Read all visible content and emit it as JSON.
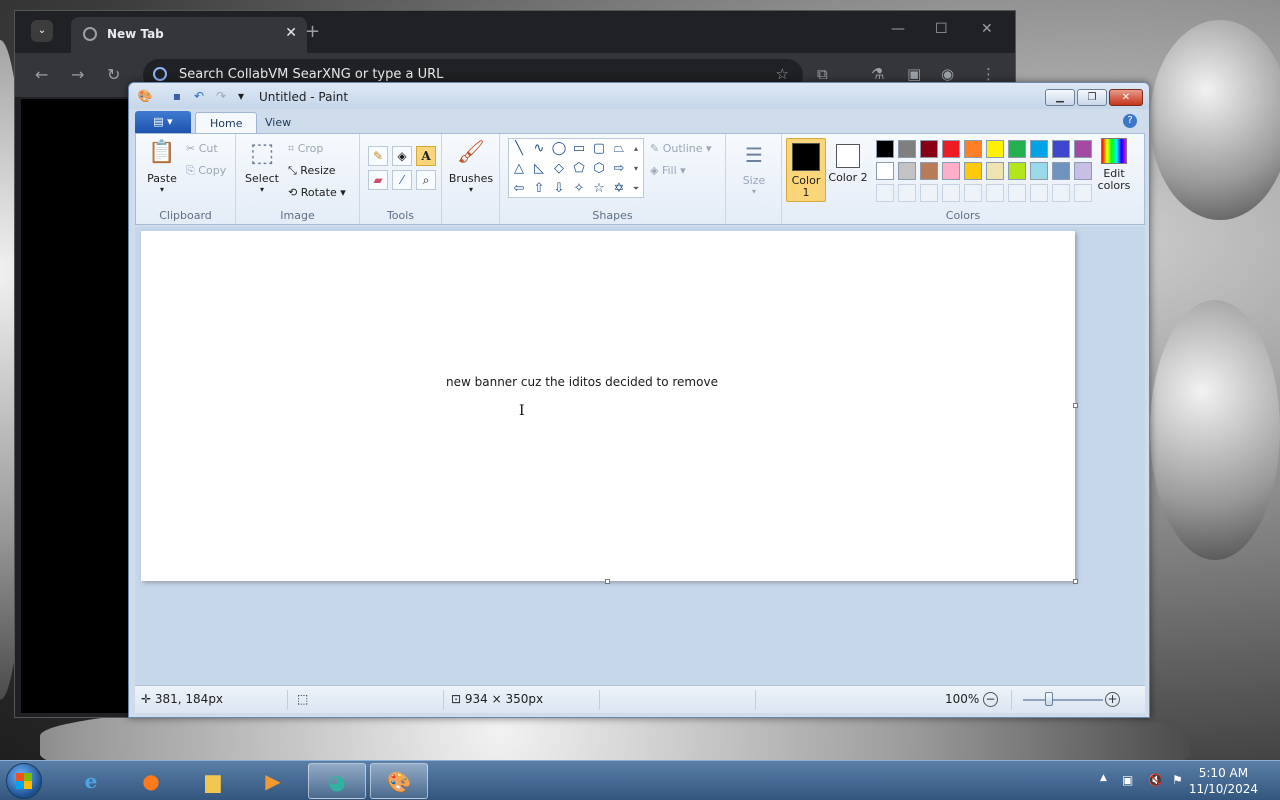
{
  "chrome": {
    "tab_title": "New Tab",
    "tab_close": "✕",
    "new_tab": "+",
    "omnibox_placeholder": "Search CollabVM SearXNG or type a URL"
  },
  "paint": {
    "window_title": "Untitled - Paint",
    "tabs": {
      "home": "Home",
      "view": "View"
    },
    "help": "?",
    "clipboard": {
      "paste": "Paste",
      "cut": "Cut",
      "copy": "Copy",
      "group": "Clipboard"
    },
    "image": {
      "select": "Select",
      "crop": "Crop",
      "resize": "Resize",
      "rotate": "Rotate",
      "group": "Image"
    },
    "tools": {
      "group": "Tools"
    },
    "brushes": {
      "label": "Brushes"
    },
    "shapes": {
      "outline": "Outline",
      "fill": "Fill",
      "group": "Shapes"
    },
    "size": {
      "label": "Size"
    },
    "colors": {
      "color1_label": "Color 1",
      "color2_label": "Color 2",
      "color1": "#000000",
      "color2": "#ffffff",
      "edit_colors": "Edit colors",
      "group": "Colors",
      "palette_row1": [
        "#000000",
        "#7f7f7f",
        "#880015",
        "#ed1c24",
        "#ff7f27",
        "#fff200",
        "#22b14c",
        "#00a2e8",
        "#3f48cc",
        "#a349a4"
      ],
      "palette_row2": [
        "#ffffff",
        "#c3c3c3",
        "#b97a57",
        "#ffaec9",
        "#ffc90e",
        "#efe4b0",
        "#b5e61d",
        "#99d9ea",
        "#7092be",
        "#c8bfe7"
      ]
    },
    "canvas_text": "new banner cuz the iditos decided to remove",
    "status": {
      "cursor_pos": "381, 184px",
      "image_size": "934 × 350px",
      "zoom": "100%"
    }
  },
  "taskbar": {
    "time": "5:10 AM",
    "date": "11/10/2024"
  }
}
